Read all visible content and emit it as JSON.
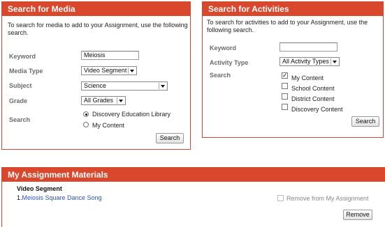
{
  "media": {
    "title": "Search for Media",
    "intro": "To search for media to add to your Assignment, use the following search.",
    "keyword_label": "Keyword",
    "keyword_value": "Meiosis",
    "media_type_label": "Media Type",
    "media_type_value": "Video Segment",
    "subject_label": "Subject",
    "subject_value": "Science",
    "grade_label": "Grade",
    "grade_value": "All Grades",
    "search_label": "Search",
    "radio_options": [
      "Discovery Education Library",
      "My Content"
    ],
    "radio_selected": 0,
    "search_button": "Search"
  },
  "activities": {
    "title": "Search for Activities",
    "intro": "To search for activities to add to your Assignment, use the following search.",
    "keyword_label": "Keyword",
    "keyword_value": "",
    "activity_type_label": "Activity Type",
    "activity_type_value": "All Activity Types",
    "search_label": "Search",
    "checkbox_options": [
      "My Content",
      "School Content",
      "District Content",
      "Discovery Content"
    ],
    "checked": [
      true,
      false,
      false,
      false
    ],
    "search_button": "Search"
  },
  "materials": {
    "title": "My Assignment Materials",
    "section_heading": "Video Segment",
    "item_number": "1.",
    "item_title": "Meiosis Square Dance Song",
    "remove_checkbox_label": "Remove from My Assignment",
    "remove_button": "Remove"
  },
  "colors": {
    "header_red": "#d9472c",
    "link_blue": "#2a54c5",
    "label_grey": "#6b6b6b"
  }
}
